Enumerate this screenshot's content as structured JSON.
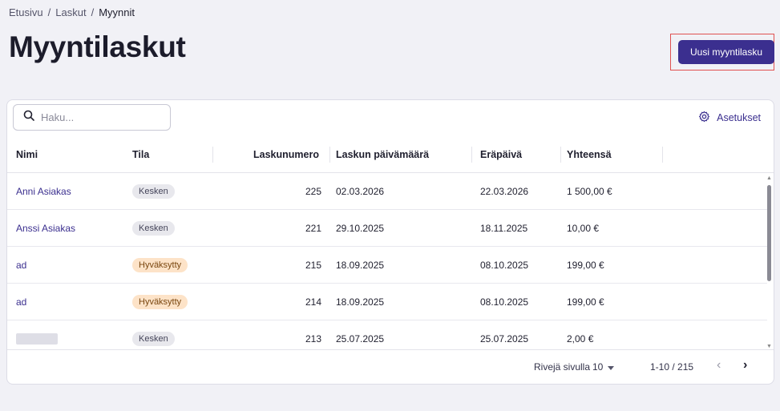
{
  "breadcrumb": {
    "home": "Etusivu",
    "invoices": "Laskut",
    "current": "Myynnit",
    "separator": "/"
  },
  "page": {
    "title": "Myyntilaskut",
    "new_button": "Uusi myyntilasku"
  },
  "toolbar": {
    "search_placeholder": "Haku...",
    "settings_label": "Asetukset"
  },
  "table": {
    "columns": [
      "Nimi",
      "Tila",
      "Laskunumero",
      "Laskun päivämäärä",
      "Eräpäivä",
      "Yhteensä"
    ],
    "rows": [
      {
        "name": "Anni Asiakas",
        "status": "Kesken",
        "number": "225",
        "date": "02.03.2026",
        "due": "22.03.2026",
        "total": "1 500,00 €"
      },
      {
        "name": "Anssi Asiakas",
        "status": "Kesken",
        "number": "221",
        "date": "29.10.2025",
        "due": "18.11.2025",
        "total": "10,00 €"
      },
      {
        "name": "ad",
        "status": "Hyväksytty",
        "number": "215",
        "date": "18.09.2025",
        "due": "08.10.2025",
        "total": "199,00 €"
      },
      {
        "name": "ad",
        "status": "Hyväksytty",
        "number": "214",
        "date": "18.09.2025",
        "due": "08.10.2025",
        "total": "199,00 €"
      },
      {
        "name": "",
        "status": "Kesken",
        "number": "213",
        "date": "25.07.2025",
        "due": "25.07.2025",
        "total": "2,00 €"
      }
    ]
  },
  "pagination": {
    "rows_per_page_label": "Rivejä sivulla",
    "rows_per_page": "10",
    "range": "1-10 / 215"
  },
  "colors": {
    "accent": "#3b2f8f",
    "highlight": "#e05050",
    "badge_gray": "#e8e8ed",
    "badge_orange": "#fde3c8"
  }
}
